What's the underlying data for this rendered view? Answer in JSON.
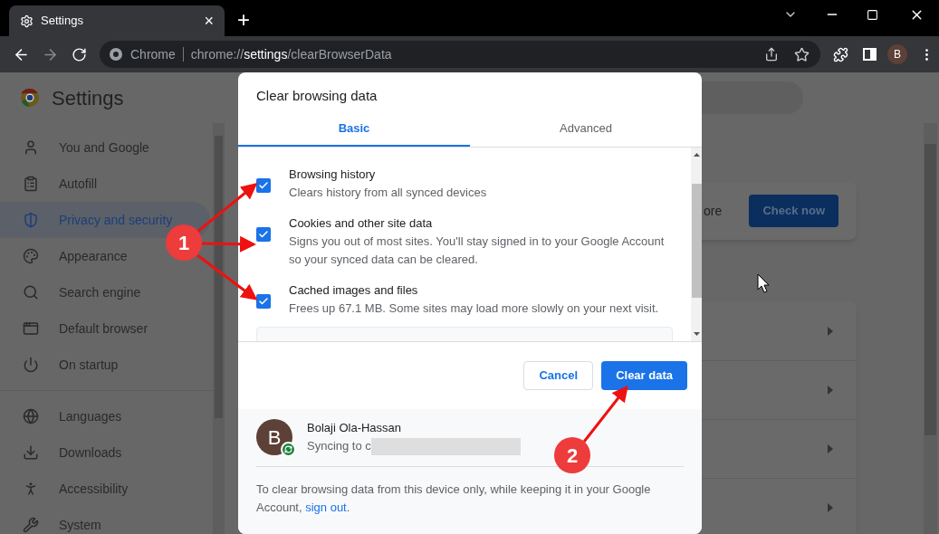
{
  "browser": {
    "tab": {
      "title": "Settings",
      "close": "×",
      "new_tab": "+"
    },
    "omnibox": {
      "chip": "Chrome",
      "url": "chrome://**settings**/clearBrowserData"
    },
    "avatar": "B"
  },
  "settings": {
    "title": "Settings",
    "sidebar": {
      "sections": [
        {
          "items": [
            {
              "label": "You and Google",
              "selected": false
            },
            {
              "label": "Autofill",
              "selected": false
            },
            {
              "label": "Privacy and security",
              "selected": true
            },
            {
              "label": "Appearance",
              "selected": false
            },
            {
              "label": "Search engine",
              "selected": false
            },
            {
              "label": "Default browser",
              "selected": false
            },
            {
              "label": "On startup",
              "selected": false
            }
          ]
        },
        {
          "items": [
            {
              "label": "Languages",
              "selected": false
            },
            {
              "label": "Downloads",
              "selected": false
            },
            {
              "label": "Accessibility",
              "selected": false
            },
            {
              "label": "System",
              "selected": false
            }
          ]
        }
      ]
    },
    "safety_card": {
      "text": "ore",
      "button": "Check now"
    }
  },
  "dialog": {
    "title": "Clear browsing data",
    "tabs": [
      {
        "label": "Basic",
        "selected": true
      },
      {
        "label": "Advanced",
        "selected": false
      }
    ],
    "options": [
      {
        "title": "Browsing history",
        "description": "Clears history from all synced devices",
        "checked": true
      },
      {
        "title": "Cookies and other site data",
        "description": "Signs you out of most sites. You'll stay signed in to your Google Account so your synced data can be cleared.",
        "checked": true
      },
      {
        "title": "Cached images and files",
        "description": "Frees up 67.1 MB. Some sites may load more slowly on your next visit.",
        "checked": true
      }
    ],
    "buttons": [
      {
        "label": "Cancel",
        "kind": "secondary"
      },
      {
        "label": "Clear data",
        "kind": "primary"
      }
    ],
    "account": {
      "initial": "B",
      "name": "Bolaji Ola-Hassan",
      "sync_text": "Syncing to c"
    },
    "note": {
      "text": "To clear browsing data from this device only, while keeping it in your Google Account, ",
      "link": "sign out",
      "end": "."
    }
  },
  "annotations": [
    {
      "label": "1"
    },
    {
      "label": "2"
    }
  ]
}
